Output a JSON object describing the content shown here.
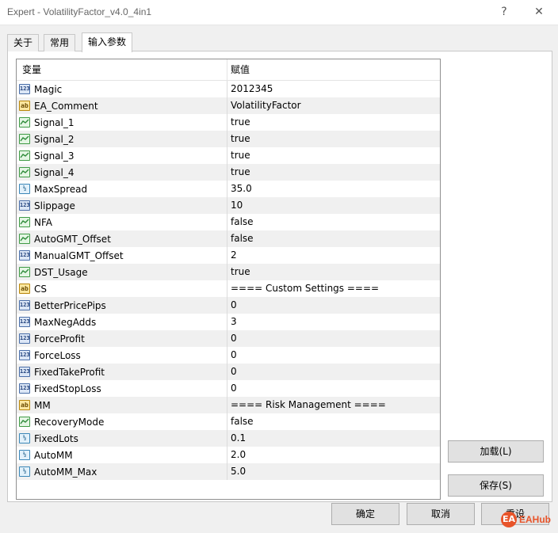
{
  "window": {
    "title": "Expert - VolatilityFactor_v4.0_4in1",
    "help_glyph": "?",
    "close_glyph": "✕"
  },
  "tabs": [
    {
      "label": "关于",
      "active": false
    },
    {
      "label": "常用",
      "active": false
    },
    {
      "label": "输入参数",
      "active": true
    }
  ],
  "grid": {
    "header": {
      "variable": "变量",
      "value": "赋值"
    },
    "rows": [
      {
        "name": "Magic",
        "value": "2012345",
        "type": "int",
        "icon": "int-icon"
      },
      {
        "name": "EA_Comment",
        "value": "VolatilityFactor",
        "type": "string",
        "icon": "string-icon"
      },
      {
        "name": "Signal_1",
        "value": "true",
        "type": "bool",
        "icon": "bool-icon"
      },
      {
        "name": "Signal_2",
        "value": "true",
        "type": "bool",
        "icon": "bool-icon"
      },
      {
        "name": "Signal_3",
        "value": "true",
        "type": "bool",
        "icon": "bool-icon"
      },
      {
        "name": "Signal_4",
        "value": "true",
        "type": "bool",
        "icon": "bool-icon"
      },
      {
        "name": "MaxSpread",
        "value": "35.0",
        "type": "double",
        "icon": "double-icon"
      },
      {
        "name": "Slippage",
        "value": "10",
        "type": "int",
        "icon": "int-icon"
      },
      {
        "name": "NFA",
        "value": "false",
        "type": "bool",
        "icon": "bool-icon"
      },
      {
        "name": "AutoGMT_Offset",
        "value": "false",
        "type": "bool",
        "icon": "bool-icon"
      },
      {
        "name": "ManualGMT_Offset",
        "value": "2",
        "type": "int",
        "icon": "int-icon"
      },
      {
        "name": "DST_Usage",
        "value": "true",
        "type": "bool",
        "icon": "bool-icon"
      },
      {
        "name": "CS",
        "value": "==== Custom Settings ====",
        "type": "string",
        "icon": "string-icon"
      },
      {
        "name": "BetterPricePips",
        "value": "0",
        "type": "int",
        "icon": "int-icon"
      },
      {
        "name": "MaxNegAdds",
        "value": "3",
        "type": "int",
        "icon": "int-icon"
      },
      {
        "name": "ForceProfit",
        "value": "0",
        "type": "int",
        "icon": "int-icon"
      },
      {
        "name": "ForceLoss",
        "value": "0",
        "type": "int",
        "icon": "int-icon"
      },
      {
        "name": "FixedTakeProfit",
        "value": "0",
        "type": "int",
        "icon": "int-icon"
      },
      {
        "name": "FixedStopLoss",
        "value": "0",
        "type": "int",
        "icon": "int-icon"
      },
      {
        "name": "MM",
        "value": "==== Risk Management ====",
        "type": "string",
        "icon": "string-icon"
      },
      {
        "name": "RecoveryMode",
        "value": "false",
        "type": "bool",
        "icon": "bool-icon"
      },
      {
        "name": "FixedLots",
        "value": "0.1",
        "type": "double",
        "icon": "double-icon"
      },
      {
        "name": "AutoMM",
        "value": "2.0",
        "type": "double",
        "icon": "double-icon"
      },
      {
        "name": "AutoMM_Max",
        "value": "5.0",
        "type": "double",
        "icon": "double-icon"
      }
    ]
  },
  "icon_glyphs": {
    "int": "123",
    "string": "ab",
    "double": "½"
  },
  "buttons": {
    "load": "加载(L)",
    "save": "保存(S)",
    "ok": "确定",
    "cancel": "取消",
    "reset": "重设"
  },
  "watermark": {
    "logo": "EA",
    "text": "EAHub"
  },
  "colors": {
    "row_alt": "#f0f0f0",
    "panel": "#ffffff",
    "watermark": "#e8542a"
  }
}
